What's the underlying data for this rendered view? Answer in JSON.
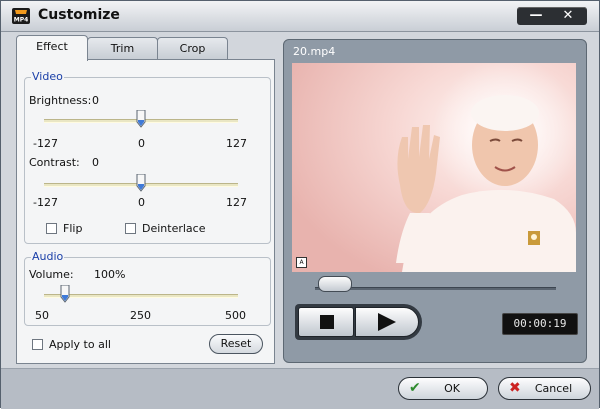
{
  "window": {
    "title": "Customize",
    "app_icon_text": "MP4",
    "minimize_label": "—",
    "close_label": "✕"
  },
  "tabs": [
    {
      "label": "Effect",
      "active": true
    },
    {
      "label": "Trim",
      "active": false
    },
    {
      "label": "Crop",
      "active": false
    }
  ],
  "video": {
    "group_label": "Video",
    "brightness": {
      "label": "Brightness:",
      "value": "0",
      "min": "-127",
      "mid": "0",
      "max": "127",
      "level": 0.5
    },
    "contrast": {
      "label": "Contrast:",
      "value": "0",
      "min": "-127",
      "mid": "0",
      "max": "127",
      "level": 0.5
    },
    "flip_label": "Flip",
    "deinterlace_label": "Deinterlace"
  },
  "audio": {
    "group_label": "Audio",
    "volume": {
      "label": "Volume:",
      "value": "100%",
      "min": "50",
      "mid": "250",
      "max": "500",
      "level": 0.11
    }
  },
  "apply_all_label": "Apply to all",
  "reset_label": "Reset",
  "preview": {
    "filename": "20.mp4",
    "timecode": "00:00:19",
    "progress": 0.05
  },
  "buttons": {
    "ok_label": "OK",
    "cancel_label": "Cancel"
  },
  "colors": {
    "accent_blue": "#1a3fa8",
    "ok_check": "#2e8b2e",
    "cancel_x": "#cc2222"
  }
}
